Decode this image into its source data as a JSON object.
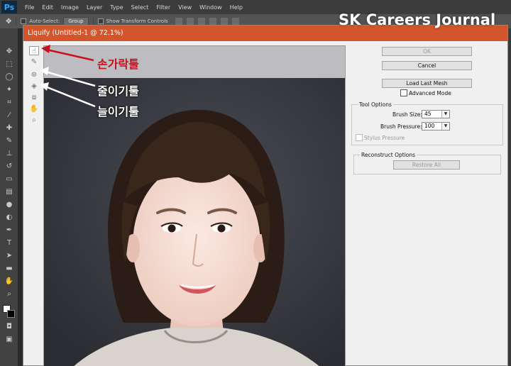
{
  "app": {
    "logo": "Ps"
  },
  "menu": [
    "File",
    "Edit",
    "Image",
    "Layer",
    "Type",
    "Select",
    "Filter",
    "View",
    "Window",
    "Help"
  ],
  "options_bar": {
    "auto_select_label": "Auto-Select:",
    "auto_select_value": "Group",
    "transform_label": "Show Transform Controls"
  },
  "dialog": {
    "title": "Liquify (Untitled-1 @ 72.1%)",
    "ok_label": "OK",
    "cancel_label": "Cancel",
    "load_last_mesh_label": "Load Last Mesh",
    "advanced_mode_label": "Advanced Mode",
    "tool_options": {
      "title": "Tool Options",
      "brush_size_label": "Brush Size:",
      "brush_size_value": "45",
      "brush_pressure_label": "Brush Pressure:",
      "brush_pressure_value": "100",
      "stylus_pressure_label": "Stylus Pressure"
    },
    "reconstruct": {
      "title": "Reconstruct Options",
      "restore_all_label": "Restore All"
    }
  },
  "overlay": {
    "watermark": "SK Careers Journal",
    "label_finger": "손가락툴",
    "label_pucker": "줄이기툴",
    "label_bloat": "늘이기툴"
  },
  "colors": {
    "title_bar": "#d2552b",
    "annotation_red": "#c8101e",
    "annotation_white": "#ffffff"
  }
}
